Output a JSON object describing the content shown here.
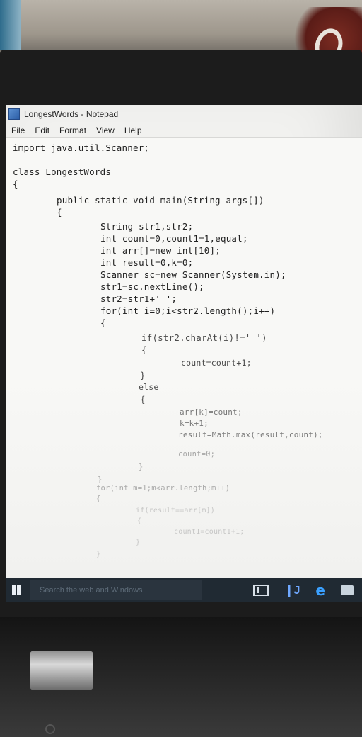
{
  "window": {
    "title": "LongestWords - Notepad"
  },
  "menu": [
    "File",
    "Edit",
    "Format",
    "View",
    "Help"
  ],
  "code_lines": [
    "import java.util.Scanner;",
    "class LongestWords",
    "{",
    "public static void main(String args[])",
    "{",
    "String str1,str2;",
    "int count=0,count1=1,equal;",
    "int arr[]=new int[10];",
    "int result=0,k=0;",
    "Scanner sc=new Scanner(System.in);",
    "str1=sc.nextLine();",
    "str2=str1+' ';",
    "for(int i=0;i<str2.length();i++)",
    "{",
    "if(str2.charAt(i)!=' ')",
    "{",
    "count=count+1;",
    "}",
    "else",
    "{",
    "arr[k]=count;",
    "k=k+1;",
    "result=Math.max(result,count);",
    "count=0;",
    "}",
    "}",
    "for(int m=1;m<arr.length;m++)",
    "{",
    "if(result==arr[m])",
    "{",
    "count1=count1+1;",
    "}",
    "}"
  ],
  "taskbar": {
    "search_placeholder": "Search the web and Windows",
    "icons": [
      "windows-start-icon",
      "task-view-icon",
      "store-app-icon",
      "edge-browser-icon",
      "file-explorer-icon"
    ]
  },
  "colors": {
    "taskbar": "#202a33",
    "editor_bg": "#f8f8f6",
    "text": "#202020"
  }
}
